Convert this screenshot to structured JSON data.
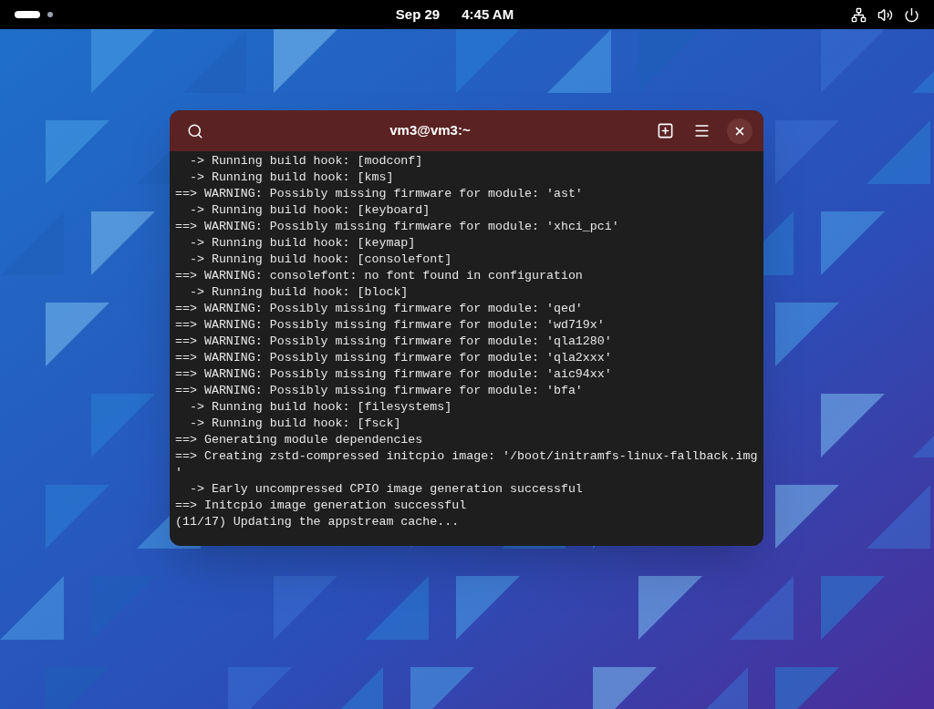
{
  "top_bar": {
    "date": "Sep 29",
    "time": "4:45 AM"
  },
  "terminal": {
    "title": "vm3@vm3:~",
    "lines": [
      "  -> Running build hook: [modconf]",
      "  -> Running build hook: [kms]",
      "==> WARNING: Possibly missing firmware for module: 'ast'",
      "  -> Running build hook: [keyboard]",
      "==> WARNING: Possibly missing firmware for module: 'xhci_pci'",
      "  -> Running build hook: [keymap]",
      "  -> Running build hook: [consolefont]",
      "==> WARNING: consolefont: no font found in configuration",
      "  -> Running build hook: [block]",
      "==> WARNING: Possibly missing firmware for module: 'qed'",
      "==> WARNING: Possibly missing firmware for module: 'wd719x'",
      "==> WARNING: Possibly missing firmware for module: 'qla1280'",
      "==> WARNING: Possibly missing firmware for module: 'qla2xxx'",
      "==> WARNING: Possibly missing firmware for module: 'aic94xx'",
      "==> WARNING: Possibly missing firmware for module: 'bfa'",
      "  -> Running build hook: [filesystems]",
      "  -> Running build hook: [fsck]",
      "==> Generating module dependencies",
      "==> Creating zstd-compressed initcpio image: '/boot/initramfs-linux-fallback.img",
      "'",
      "  -> Early uncompressed CPIO image generation successful",
      "==> Initcpio image generation successful",
      "(11/17) Updating the appstream cache..."
    ]
  }
}
